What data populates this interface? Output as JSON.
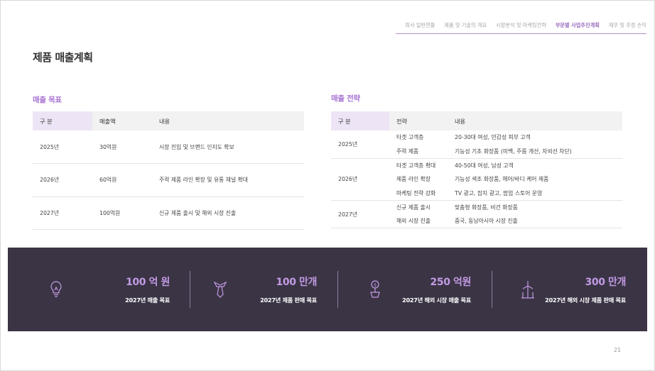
{
  "nav": {
    "items": [
      "회사 일반현황",
      "제품 및 기술의 개요",
      "시장분석 및 마케팅전략",
      "부문별 사업추진계획",
      "재무 및 추정 손익"
    ],
    "active_index": 3
  },
  "page_title": "제품 매출계획",
  "sales_target": {
    "title": "매출 목표",
    "headers": [
      "구 분",
      "매출액",
      "내용"
    ],
    "rows": [
      [
        "2025년",
        "30억원",
        "시장 진입 및 브랜드 인지도 확보"
      ],
      [
        "2026년",
        "60억원",
        "주력 제품 라인 확장 및 유통 채널 확대"
      ],
      [
        "2027년",
        "100억원",
        "신규 제품 출시 및 해외 시장 진출"
      ]
    ]
  },
  "sales_strategy": {
    "title": "매출 전략",
    "headers": [
      "구 분",
      "전략",
      "내용"
    ],
    "groups": [
      {
        "year": "2025년",
        "rows": [
          [
            "타겟 고객층",
            "20-30대 여성, 민감성 피부 고객"
          ],
          [
            "주력 제품",
            "기능성 기초 화장품 (미백, 주름 개선, 자외선 차단)"
          ]
        ]
      },
      {
        "year": "2026년",
        "rows": [
          [
            "타겟 고객층 확대",
            "40-50대 여성, 남성 고객"
          ],
          [
            "제품 라인 확장",
            "기능성 색조 화장품, 헤어/바디 케어 제품"
          ],
          [
            "마케팅 전략 강화",
            "TV 광고, 잡지 광고, 팝업 스토어 운영"
          ]
        ]
      },
      {
        "year": "2027년",
        "rows": [
          [
            "신규 제품 출시",
            "맞춤형 화장품, 비건 화장품"
          ],
          [
            "해외 시장 진출",
            "중국, 동남아시아 시장 진출"
          ]
        ]
      }
    ]
  },
  "stats": [
    {
      "icon": "lightbulb-icon",
      "value": "100 억 원",
      "label": "2027년 매출 목표"
    },
    {
      "icon": "necktie-icon",
      "value": "100 만개",
      "label": "2027년 제품 판매 목표"
    },
    {
      "icon": "money-plant-icon",
      "value": "250 억원",
      "label": "2027년 해외 시장 매출 목표"
    },
    {
      "icon": "wind-turbine-icon",
      "value": "300 만개",
      "label": "2027년 해외 시장 제품 판매 목표"
    }
  ],
  "page_number": "21",
  "colors": {
    "accent": "#a874d2",
    "band": "#3b3445",
    "stat_value": "#c29be4"
  }
}
